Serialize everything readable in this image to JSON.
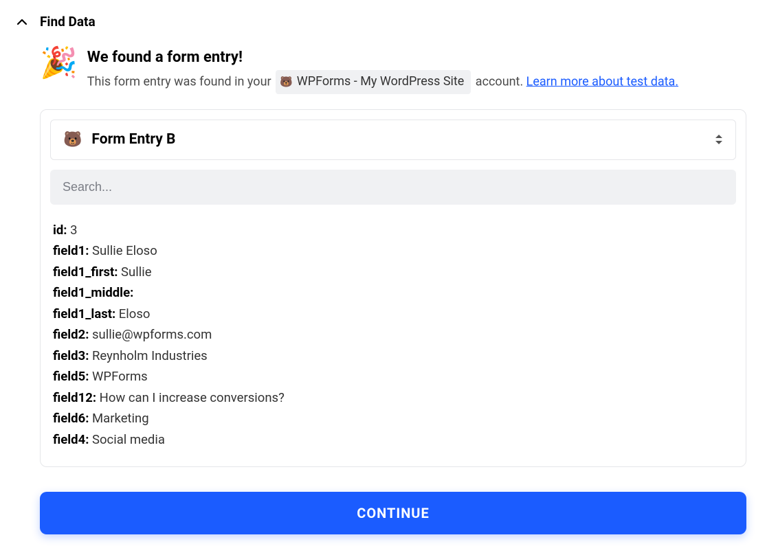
{
  "header": {
    "title": "Find Data"
  },
  "found": {
    "heading": "We found a form entry!",
    "desc_prefix": "This form entry was found in your ",
    "account_chip": "WPForms - My WordPress Site",
    "desc_suffix": " account. ",
    "learn_link": "Learn more about test data."
  },
  "entry": {
    "selected": "Form Entry B"
  },
  "search": {
    "placeholder": "Search..."
  },
  "fields": [
    {
      "key": "id:",
      "value": "3"
    },
    {
      "key": "field1:",
      "value": "Sullie Eloso"
    },
    {
      "key": "field1_first:",
      "value": "Sullie"
    },
    {
      "key": "field1_middle:",
      "value": ""
    },
    {
      "key": "field1_last:",
      "value": "Eloso"
    },
    {
      "key": "field2:",
      "value": "sullie@wpforms.com"
    },
    {
      "key": "field3:",
      "value": "Reynholm Industries"
    },
    {
      "key": "field5:",
      "value": "WPForms"
    },
    {
      "key": "field12:",
      "value": "How can I increase conversions?"
    },
    {
      "key": "field6:",
      "value": "Marketing"
    },
    {
      "key": "field4:",
      "value": "Social media"
    }
  ],
  "continue": {
    "label": "CONTINUE"
  }
}
